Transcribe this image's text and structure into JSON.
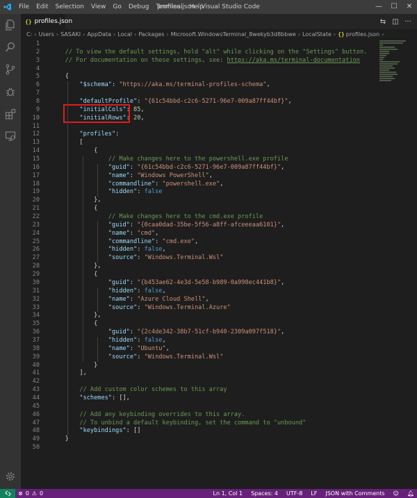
{
  "window": {
    "title": "profiles.json - Visual Studio Code",
    "menu": [
      "File",
      "Edit",
      "Selection",
      "View",
      "Go",
      "Debug",
      "Terminal",
      "Help"
    ],
    "controls": [
      "—",
      "☐",
      "✕"
    ]
  },
  "tab": {
    "label": "profiles.json",
    "icon": "json-braces-icon"
  },
  "breadcrumb": [
    "C:",
    "Users",
    "SASAKI",
    "AppData",
    "Local",
    "Packages",
    "Microsoft.WindowsTerminal_8wekyb3d8bbwe",
    "LocalState",
    "profiles.json"
  ],
  "editor": {
    "lines": [
      {
        "n": "1",
        "t": []
      },
      {
        "n": "2",
        "t": [
          {
            "c": "c",
            "v": "    // To view the default settings, hold \"alt\" while clicking on the \"Settings\" button."
          }
        ]
      },
      {
        "n": "3",
        "t": [
          {
            "c": "c",
            "v": "    // For documentation on these settings, see: "
          },
          {
            "c": "link",
            "v": "https://aka.ms/terminal-documentation"
          }
        ]
      },
      {
        "n": "4",
        "t": []
      },
      {
        "n": "5",
        "t": [
          {
            "c": "txt",
            "v": "    {"
          }
        ]
      },
      {
        "n": "6",
        "t": [
          {
            "c": "txt",
            "v": "        "
          },
          {
            "c": "k",
            "v": "\"$schema\""
          },
          {
            "c": "txt",
            "v": ": "
          },
          {
            "c": "s",
            "v": "\"https://aka.ms/terminal-profiles-schema\""
          },
          {
            "c": "txt",
            "v": ","
          }
        ]
      },
      {
        "n": "7",
        "t": []
      },
      {
        "n": "8",
        "t": [
          {
            "c": "txt",
            "v": "        "
          },
          {
            "c": "k",
            "v": "\"defaultProfile\""
          },
          {
            "c": "txt",
            "v": ": "
          },
          {
            "c": "s",
            "v": "\"{61c54bbd-c2c6-5271-96e7-009a87ff44bf}\""
          },
          {
            "c": "txt",
            "v": ","
          }
        ]
      },
      {
        "n": "9",
        "t": [
          {
            "c": "txt",
            "v": "        "
          },
          {
            "c": "k",
            "v": "\"initialCols\""
          },
          {
            "c": "txt",
            "v": ": "
          },
          {
            "c": "n",
            "v": "85"
          },
          {
            "c": "txt",
            "v": ","
          }
        ]
      },
      {
        "n": "10",
        "t": [
          {
            "c": "txt",
            "v": "        "
          },
          {
            "c": "k",
            "v": "\"initialRows\""
          },
          {
            "c": "txt",
            "v": ": "
          },
          {
            "c": "n",
            "v": "20"
          },
          {
            "c": "txt",
            "v": ","
          }
        ]
      },
      {
        "n": "11",
        "t": []
      },
      {
        "n": "12",
        "t": [
          {
            "c": "txt",
            "v": "        "
          },
          {
            "c": "k",
            "v": "\"profiles\""
          },
          {
            "c": "txt",
            "v": ":"
          }
        ]
      },
      {
        "n": "13",
        "t": [
          {
            "c": "txt",
            "v": "        ["
          }
        ]
      },
      {
        "n": "14",
        "t": [
          {
            "c": "txt",
            "v": "            {"
          }
        ]
      },
      {
        "n": "15",
        "t": [
          {
            "c": "txt",
            "v": "                "
          },
          {
            "c": "c",
            "v": "// Make changes here to the powershell.exe profile"
          }
        ]
      },
      {
        "n": "16",
        "t": [
          {
            "c": "txt",
            "v": "                "
          },
          {
            "c": "k",
            "v": "\"guid\""
          },
          {
            "c": "txt",
            "v": ": "
          },
          {
            "c": "s",
            "v": "\"{61c54bbd-c2c6-5271-96e7-009a87ff44bf}\""
          },
          {
            "c": "txt",
            "v": ","
          }
        ]
      },
      {
        "n": "17",
        "t": [
          {
            "c": "txt",
            "v": "                "
          },
          {
            "c": "k",
            "v": "\"name\""
          },
          {
            "c": "txt",
            "v": ": "
          },
          {
            "c": "s",
            "v": "\"Windows PowerShell\""
          },
          {
            "c": "txt",
            "v": ","
          }
        ]
      },
      {
        "n": "18",
        "t": [
          {
            "c": "txt",
            "v": "                "
          },
          {
            "c": "k",
            "v": "\"commandline\""
          },
          {
            "c": "txt",
            "v": ": "
          },
          {
            "c": "s",
            "v": "\"powershell.exe\""
          },
          {
            "c": "txt",
            "v": ","
          }
        ]
      },
      {
        "n": "19",
        "t": [
          {
            "c": "txt",
            "v": "                "
          },
          {
            "c": "k",
            "v": "\"hidden\""
          },
          {
            "c": "txt",
            "v": ": "
          },
          {
            "c": "b",
            "v": "false"
          }
        ]
      },
      {
        "n": "20",
        "t": [
          {
            "c": "txt",
            "v": "            },"
          }
        ]
      },
      {
        "n": "21",
        "t": [
          {
            "c": "txt",
            "v": "            {"
          }
        ]
      },
      {
        "n": "22",
        "t": [
          {
            "c": "txt",
            "v": "                "
          },
          {
            "c": "c",
            "v": "// Make changes here to the cmd.exe profile"
          }
        ]
      },
      {
        "n": "23",
        "t": [
          {
            "c": "txt",
            "v": "                "
          },
          {
            "c": "k",
            "v": "\"guid\""
          },
          {
            "c": "txt",
            "v": ": "
          },
          {
            "c": "s",
            "v": "\"{0caa0dad-35be-5f56-a8ff-afceeeaa6101}\""
          },
          {
            "c": "txt",
            "v": ","
          }
        ]
      },
      {
        "n": "24",
        "t": [
          {
            "c": "txt",
            "v": "                "
          },
          {
            "c": "k",
            "v": "\"name\""
          },
          {
            "c": "txt",
            "v": ": "
          },
          {
            "c": "s",
            "v": "\"cmd\""
          },
          {
            "c": "txt",
            "v": ","
          }
        ]
      },
      {
        "n": "25",
        "t": [
          {
            "c": "txt",
            "v": "                "
          },
          {
            "c": "k",
            "v": "\"commandline\""
          },
          {
            "c": "txt",
            "v": ": "
          },
          {
            "c": "s",
            "v": "\"cmd.exe\""
          },
          {
            "c": "txt",
            "v": ","
          }
        ]
      },
      {
        "n": "26",
        "t": [
          {
            "c": "txt",
            "v": "                "
          },
          {
            "c": "k",
            "v": "\"hidden\""
          },
          {
            "c": "txt",
            "v": ": "
          },
          {
            "c": "b",
            "v": "false"
          },
          {
            "c": "txt",
            "v": ","
          }
        ]
      },
      {
        "n": "27",
        "t": [
          {
            "c": "txt",
            "v": "                "
          },
          {
            "c": "k",
            "v": "\"source\""
          },
          {
            "c": "txt",
            "v": ": "
          },
          {
            "c": "s",
            "v": "\"Windows.Terminal.Wsl\""
          }
        ]
      },
      {
        "n": "28",
        "t": [
          {
            "c": "txt",
            "v": "            },"
          }
        ]
      },
      {
        "n": "29",
        "t": [
          {
            "c": "txt",
            "v": "            {"
          }
        ]
      },
      {
        "n": "30",
        "t": [
          {
            "c": "txt",
            "v": "                "
          },
          {
            "c": "k",
            "v": "\"guid\""
          },
          {
            "c": "txt",
            "v": ": "
          },
          {
            "c": "s",
            "v": "\"{b453ae62-4e3d-5e58-b989-0a998ec441b8}\""
          },
          {
            "c": "txt",
            "v": ","
          }
        ]
      },
      {
        "n": "31",
        "t": [
          {
            "c": "txt",
            "v": "                "
          },
          {
            "c": "k",
            "v": "\"hidden\""
          },
          {
            "c": "txt",
            "v": ": "
          },
          {
            "c": "b",
            "v": "false"
          },
          {
            "c": "txt",
            "v": ","
          }
        ]
      },
      {
        "n": "32",
        "t": [
          {
            "c": "txt",
            "v": "                "
          },
          {
            "c": "k",
            "v": "\"name\""
          },
          {
            "c": "txt",
            "v": ": "
          },
          {
            "c": "s",
            "v": "\"Azure Cloud Shell\""
          },
          {
            "c": "txt",
            "v": ","
          }
        ]
      },
      {
        "n": "33",
        "t": [
          {
            "c": "txt",
            "v": "                "
          },
          {
            "c": "k",
            "v": "\"source\""
          },
          {
            "c": "txt",
            "v": ": "
          },
          {
            "c": "s",
            "v": "\"Windows.Terminal.Azure\""
          }
        ]
      },
      {
        "n": "34",
        "t": [
          {
            "c": "txt",
            "v": "            },"
          }
        ]
      },
      {
        "n": "35",
        "t": [
          {
            "c": "txt",
            "v": "            {"
          }
        ]
      },
      {
        "n": "36",
        "t": [
          {
            "c": "txt",
            "v": "                "
          },
          {
            "c": "k",
            "v": "\"guid\""
          },
          {
            "c": "txt",
            "v": ": "
          },
          {
            "c": "s",
            "v": "\"{2c4de342-38b7-51cf-b940-2309a097f518}\""
          },
          {
            "c": "txt",
            "v": ","
          }
        ]
      },
      {
        "n": "37",
        "t": [
          {
            "c": "txt",
            "v": "                "
          },
          {
            "c": "k",
            "v": "\"hidden\""
          },
          {
            "c": "txt",
            "v": ": "
          },
          {
            "c": "b",
            "v": "false"
          },
          {
            "c": "txt",
            "v": ","
          }
        ]
      },
      {
        "n": "38",
        "t": [
          {
            "c": "txt",
            "v": "                "
          },
          {
            "c": "k",
            "v": "\"name\""
          },
          {
            "c": "txt",
            "v": ": "
          },
          {
            "c": "s",
            "v": "\"Ubuntu\""
          },
          {
            "c": "txt",
            "v": ","
          }
        ]
      },
      {
        "n": "39",
        "t": [
          {
            "c": "txt",
            "v": "                "
          },
          {
            "c": "k",
            "v": "\"source\""
          },
          {
            "c": "txt",
            "v": ": "
          },
          {
            "c": "s",
            "v": "\"Windows.Terminal.Wsl\""
          }
        ]
      },
      {
        "n": "40",
        "t": [
          {
            "c": "txt",
            "v": "            }"
          }
        ]
      },
      {
        "n": "41",
        "t": [
          {
            "c": "txt",
            "v": "        ],"
          }
        ]
      },
      {
        "n": "42",
        "t": []
      },
      {
        "n": "43",
        "t": [
          {
            "c": "txt",
            "v": "        "
          },
          {
            "c": "c",
            "v": "// Add custom color schemes to this array"
          }
        ]
      },
      {
        "n": "44",
        "t": [
          {
            "c": "txt",
            "v": "        "
          },
          {
            "c": "k",
            "v": "\"schemes\""
          },
          {
            "c": "txt",
            "v": ": [],"
          }
        ]
      },
      {
        "n": "45",
        "t": []
      },
      {
        "n": "46",
        "t": [
          {
            "c": "txt",
            "v": "        "
          },
          {
            "c": "c",
            "v": "// Add any keybinding overrides to this array."
          }
        ]
      },
      {
        "n": "47",
        "t": [
          {
            "c": "txt",
            "v": "        "
          },
          {
            "c": "c",
            "v": "// To unbind a default keybinding, set the command to \"unbound\""
          }
        ]
      },
      {
        "n": "48",
        "t": [
          {
            "c": "txt",
            "v": "        "
          },
          {
            "c": "k",
            "v": "\"keybindings\""
          },
          {
            "c": "txt",
            "v": ": []"
          }
        ]
      },
      {
        "n": "49",
        "t": [
          {
            "c": "txt",
            "v": "    }"
          }
        ]
      },
      {
        "n": "50",
        "t": []
      }
    ]
  },
  "status": {
    "errors": "0",
    "warnings": "0",
    "position": "Ln 1, Col 1",
    "spaces": "Spaces: 4",
    "encoding": "UTF-8",
    "eol": "LF",
    "language": "JSON with Comments"
  },
  "colors": {
    "titlebar": "#3c3c3c",
    "activitybar": "#333333",
    "editor": "#1e1e1e",
    "statusbar": "#68217a",
    "remote": "#16825d",
    "highlight_box": "#e21d1d"
  }
}
